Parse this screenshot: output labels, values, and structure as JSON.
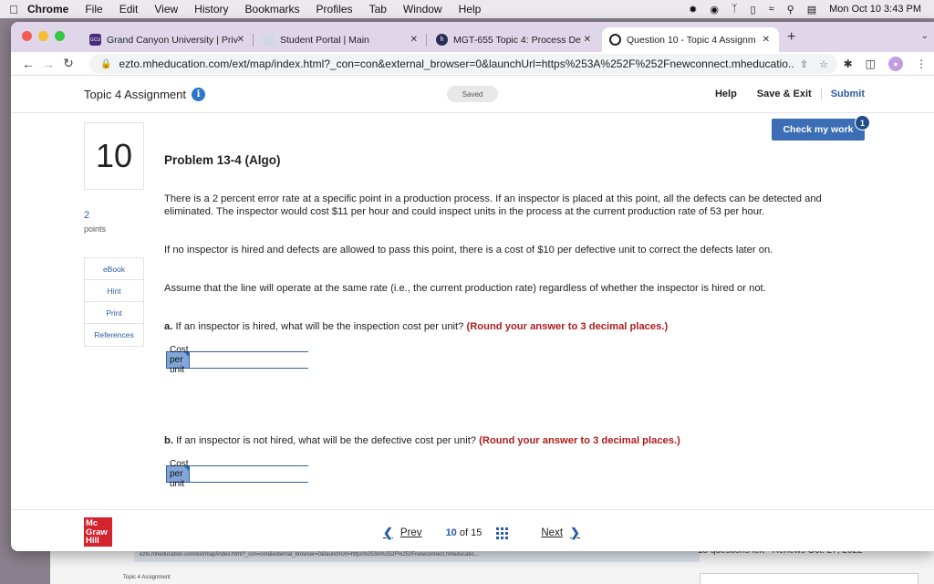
{
  "menubar": {
    "app": "Chrome",
    "items": [
      "File",
      "Edit",
      "View",
      "History",
      "Bookmarks",
      "Profiles",
      "Tab",
      "Window",
      "Help"
    ],
    "clock": "Mon Oct 10  3:43 PM"
  },
  "tabs": [
    {
      "title": "Grand Canyon University | Priv",
      "favicon": "GCU"
    },
    {
      "title": "Student Portal | Main",
      "favicon": ""
    },
    {
      "title": "MGT-655 Topic 4: Process De",
      "favicon": "h"
    },
    {
      "title": "Question 10 - Topic 4 Assignm",
      "favicon": ""
    }
  ],
  "toolbar": {
    "url": "ezto.mheducation.com/ext/map/index.html?_con=con&external_browser=0&launchUrl=https%253A%252F%252Fnewconnect.mheducatio..."
  },
  "header": {
    "assignment_title": "Topic 4 Assignment",
    "saved_label": "Saved",
    "help": "Help",
    "save_exit": "Save & Exit",
    "submit": "Submit",
    "check_my_work": "Check my work",
    "check_badge": "1"
  },
  "question": {
    "number": "10",
    "points_value": "2",
    "points_label": "points",
    "resources": [
      "eBook",
      "Hint",
      "Print",
      "References"
    ],
    "title": "Problem 13-4 (Algo)",
    "para1": "There is a 2 percent error rate at a specific point in a production process. If an inspector is placed at this point, all the defects can be detected and eliminated. The inspector would cost $11 per hour and could inspect units in the process at the current production rate of 53 per hour.",
    "para2": "If no inspector is hired and defects are allowed to pass this point, there is a cost of $10 per defective unit to correct the defects later on.",
    "para3": "Assume that the line will operate at the same rate (i.e., the current production rate) regardless of whether the inspector is hired or not.",
    "part_a_label": "a.",
    "part_a_text": "If an inspector is hired, what will be the inspection cost per unit?",
    "part_a_note": "(Round your answer to 3 decimal places.)",
    "part_a_field_label": "Cost per unit",
    "part_a_value": "",
    "part_b_label": "b.",
    "part_b_text": "If an inspector is not hired, what will be the defective cost per unit?",
    "part_b_note": "(Round your answer to 3 decimal places.)",
    "part_b_field_label": "Cost per unit",
    "part_b_value": ""
  },
  "footer": {
    "logo_lines": [
      "Mc",
      "Graw",
      "Hill"
    ],
    "prev": "Prev",
    "current": "10",
    "of": "of",
    "total": "15",
    "next": "Next"
  },
  "background_window": {
    "url_snippet": "ezto.mheducation.com/ext/map/index.html?_con=con&external_browser=0&launchUrl=https%253A%252F%252Fnewconnect.mheducatio...",
    "right_text": "18 questions left - Renews Oct. 27, 2022",
    "assignment_title": "Topic 4 Assignment"
  }
}
